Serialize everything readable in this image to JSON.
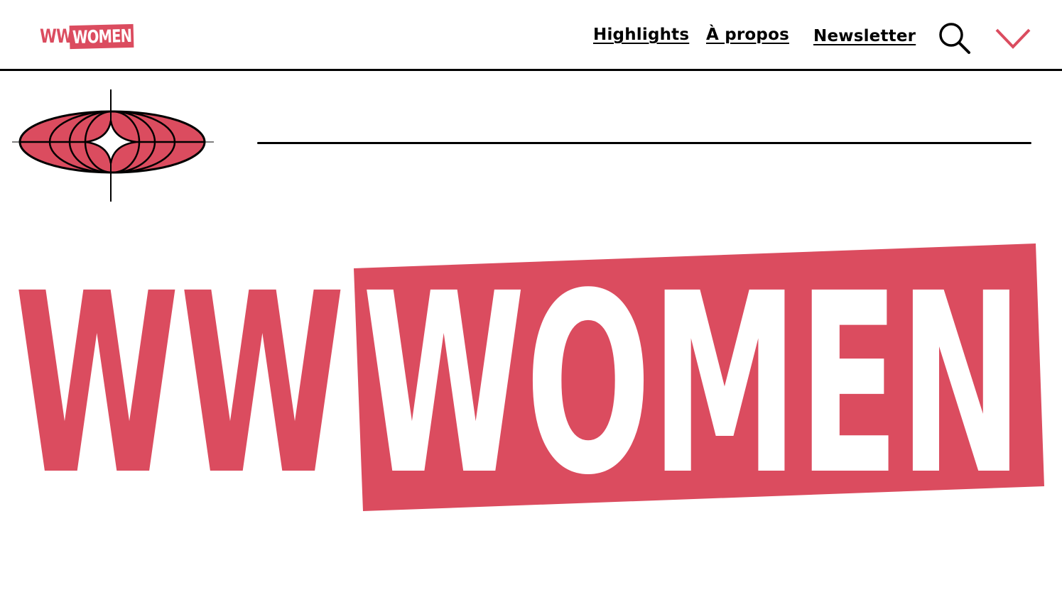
{
  "header": {
    "logo": {
      "ww": "WW",
      "women": "WOMEN"
    },
    "nav": [
      {
        "label": "Highlights"
      },
      {
        "label": "À propos"
      },
      {
        "label": "Newsletter"
      }
    ],
    "search_icon": "search-icon",
    "menu_icon": "chevron-down-icon"
  },
  "hero": {
    "emblem_icon": "globe-star-icon",
    "wordmark": {
      "ww": "WW",
      "women": "WOMEN"
    }
  },
  "colors": {
    "brand": "#DB4C5F",
    "text": "#000000",
    "background": "#FFFFFF"
  }
}
